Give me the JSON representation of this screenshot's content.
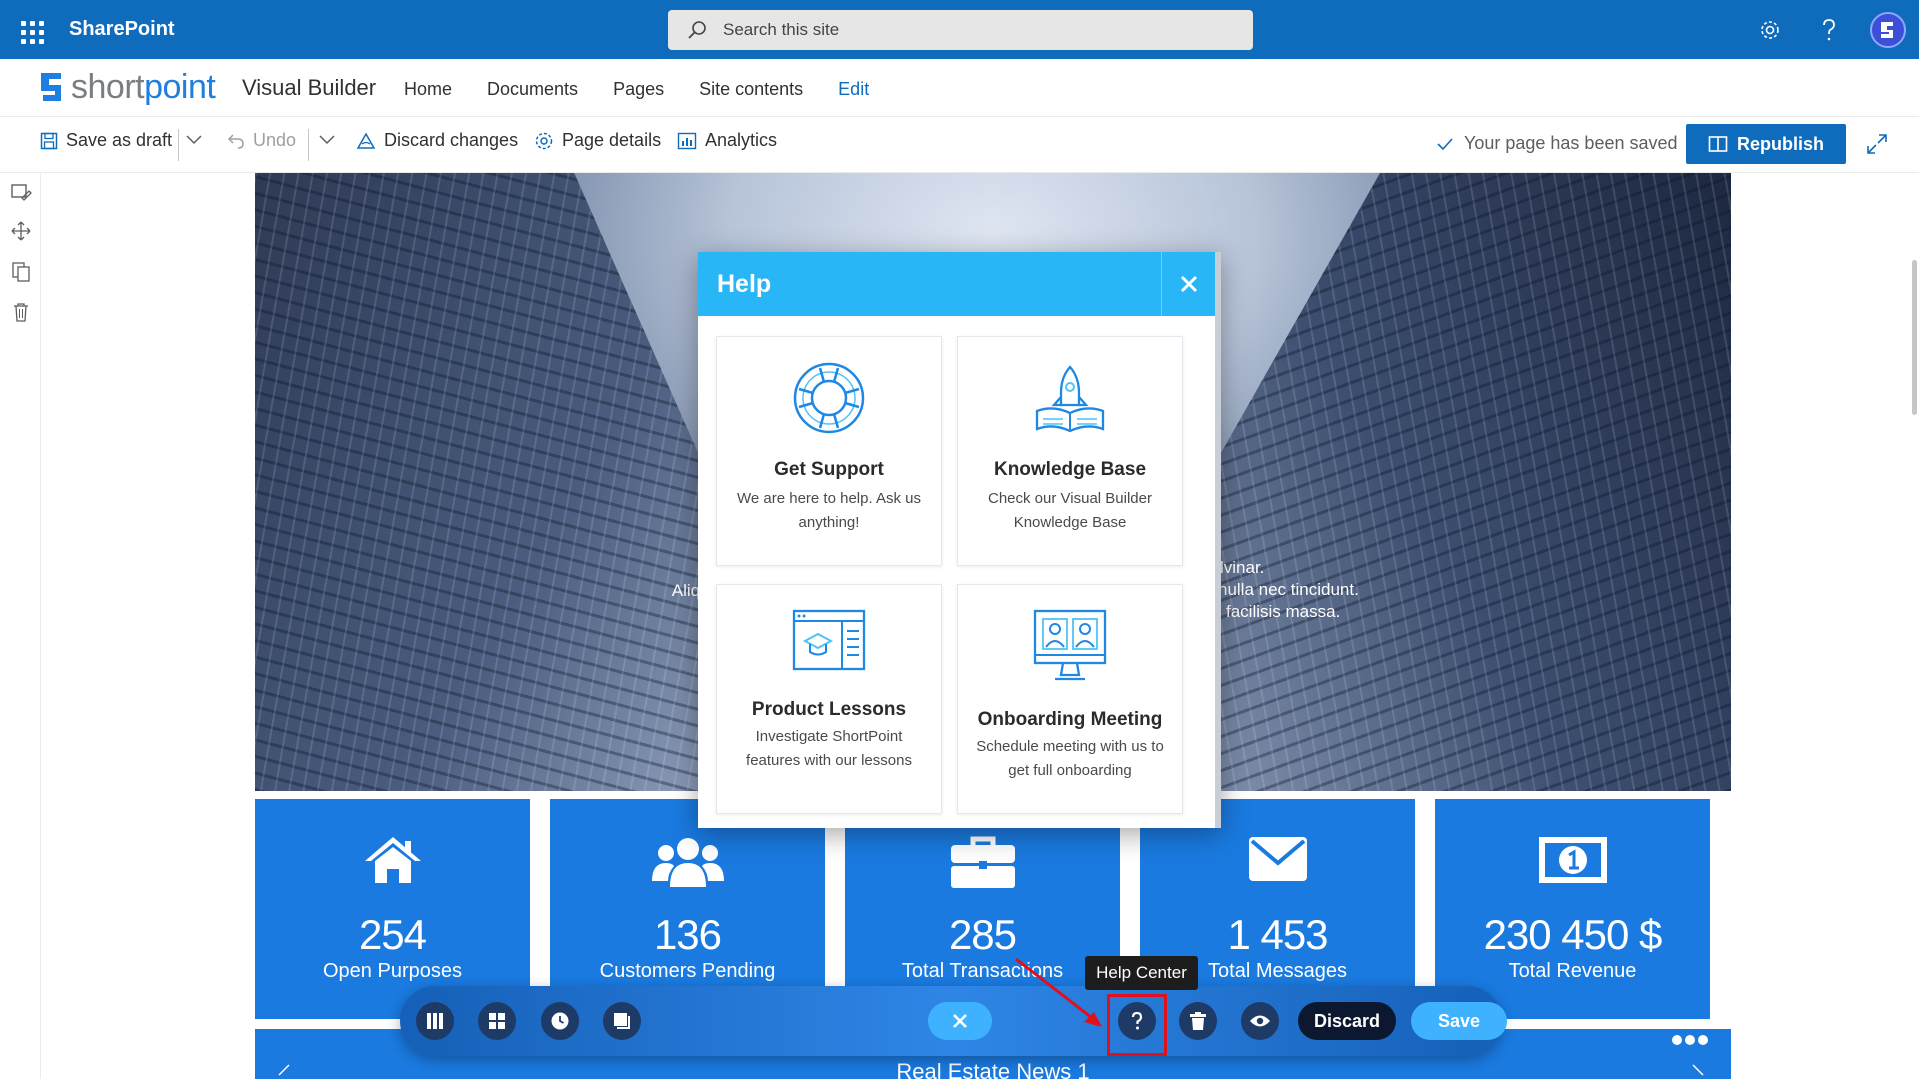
{
  "suite": {
    "brand": "SharePoint",
    "search_placeholder": "Search this site",
    "avatar_initial": "S"
  },
  "site": {
    "logo_text_short": "short",
    "logo_text_point": "point",
    "product": "Visual Builder",
    "nav": [
      "Home",
      "Documents",
      "Pages",
      "Site contents",
      "Edit"
    ]
  },
  "commands": {
    "save_draft": "Save as draft",
    "undo": "Undo",
    "discard": "Discard changes",
    "page_details": "Page details",
    "analytics": "Analytics",
    "saved_status": "Your page has been saved",
    "republish": "Republish"
  },
  "hero": {
    "text_left_1": "Aliquam gr",
    "text_left_2": "Aliquar",
    "text_right_1": "lvinar.",
    "text_right_2": "nulla nec tincidunt.",
    "text_right_3": "facilisis massa."
  },
  "stats": [
    {
      "value": "254",
      "label": "Open Purposes",
      "icon": "home-icon"
    },
    {
      "value": "136",
      "label": "Customers Pending",
      "icon": "users-icon"
    },
    {
      "value": "285",
      "label": "Total Transactions",
      "icon": "briefcase-icon"
    },
    {
      "value": "1 453",
      "label": "Total Messages",
      "icon": "envelope-icon"
    },
    {
      "value": "230 450 $",
      "label": "Total Revenue",
      "icon": "money-icon"
    }
  ],
  "news": {
    "title": "Real Estate News 1"
  },
  "help": {
    "title": "Help",
    "cards": [
      {
        "title": "Get Support",
        "desc": "We are here to help. Ask us anything!",
        "icon": "lifebuoy-icon"
      },
      {
        "title": "Knowledge Base",
        "desc": "Check our Visual Builder Knowledge Base",
        "icon": "rocket-book-icon"
      },
      {
        "title": "Product Lessons",
        "desc": "Investigate ShortPoint features with our lessons",
        "icon": "lessons-icon"
      },
      {
        "title": "Onboarding Meeting",
        "desc": "Schedule meeting with us to get full onboarding",
        "icon": "meeting-icon"
      }
    ]
  },
  "toolbar": {
    "tooltip": "Help Center",
    "discard": "Discard",
    "save": "Save"
  },
  "colors": {
    "suite_blue": "#0f6cbd",
    "tile_blue": "#1a7ae0",
    "modal_header": "#29b6f6",
    "highlight_red": "#e0101d"
  }
}
